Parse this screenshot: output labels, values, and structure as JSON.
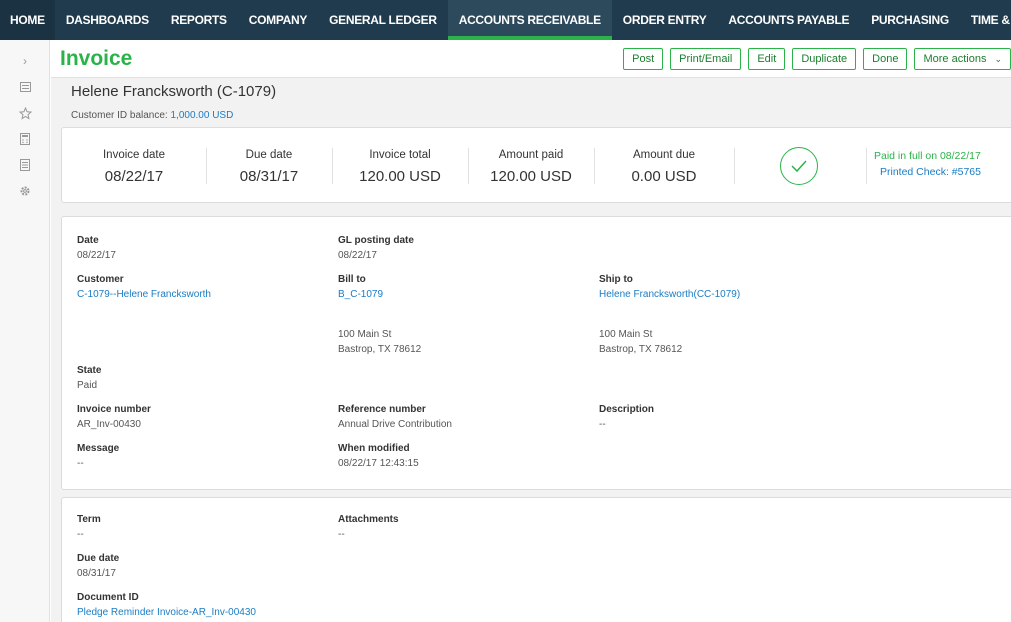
{
  "nav": {
    "items": [
      "HOME",
      "DASHBOARDS",
      "REPORTS",
      "COMPANY",
      "GENERAL LEDGER",
      "ACCOUNTS RECEIVABLE",
      "ORDER ENTRY",
      "ACCOUNTS PAYABLE",
      "PURCHASING",
      "TIME & EXPENSES"
    ],
    "active": "ACCOUNTS RECEIVABLE",
    "more": ">"
  },
  "rail": {
    "collapse": "›",
    "icons": [
      "list-icon",
      "star-icon",
      "calculator-icon",
      "document-icon",
      "settings-icon"
    ]
  },
  "page": {
    "title": "Invoice",
    "actions": [
      "Post",
      "Print/Email",
      "Edit",
      "Duplicate",
      "Done",
      "More actions"
    ]
  },
  "customer": {
    "name": "Helene Francksworth (C-1079)",
    "balance_label": "Customer ID balance:",
    "balance_value": "1,000.00 USD"
  },
  "summary": {
    "invoice_date_label": "Invoice date",
    "invoice_date": "08/22/17",
    "due_date_label": "Due date",
    "due_date": "08/31/17",
    "invoice_total_label": "Invoice total",
    "invoice_total": "120.00 USD",
    "amount_paid_label": "Amount paid",
    "amount_paid": "120.00 USD",
    "amount_due_label": "Amount due",
    "amount_due": "0.00 USD",
    "paid_status": "Paid in full on 08/22/17",
    "printed_check": "Printed Check: #5765"
  },
  "details": {
    "date_label": "Date",
    "date": "08/22/17",
    "gl_label": "GL posting date",
    "gl": "08/22/17",
    "customer_label": "Customer",
    "customer": "C-1079--Helene Francksworth",
    "billto_label": "Bill to",
    "billto": "B_C-1079",
    "shipto_label": "Ship to",
    "shipto": "Helene Francksworth(CC-1079)",
    "bill_addr1": "100 Main St",
    "bill_addr2": "Bastrop, TX 78612",
    "ship_addr1": "100 Main St",
    "ship_addr2": "Bastrop, TX 78612",
    "state_label": "State",
    "state": "Paid",
    "invnum_label": "Invoice number",
    "invnum": "AR_Inv-00430",
    "refnum_label": "Reference number",
    "refnum": "Annual Drive Contribution",
    "desc_label": "Description",
    "desc": "--",
    "message_label": "Message",
    "message": "--",
    "modified_label": "When modified",
    "modified": "08/22/17 12:43:15"
  },
  "terms": {
    "term_label": "Term",
    "term": "--",
    "attach_label": "Attachments",
    "attach": "--",
    "due_label": "Due date",
    "due": "08/31/17",
    "docid_label": "Document ID",
    "docid": "Pledge Reminder Invoice-AR_Inv-00430"
  },
  "colors": {
    "nav_bg": "#1f3b4d",
    "accent": "#2bb34a",
    "link": "#1a7dc4"
  }
}
